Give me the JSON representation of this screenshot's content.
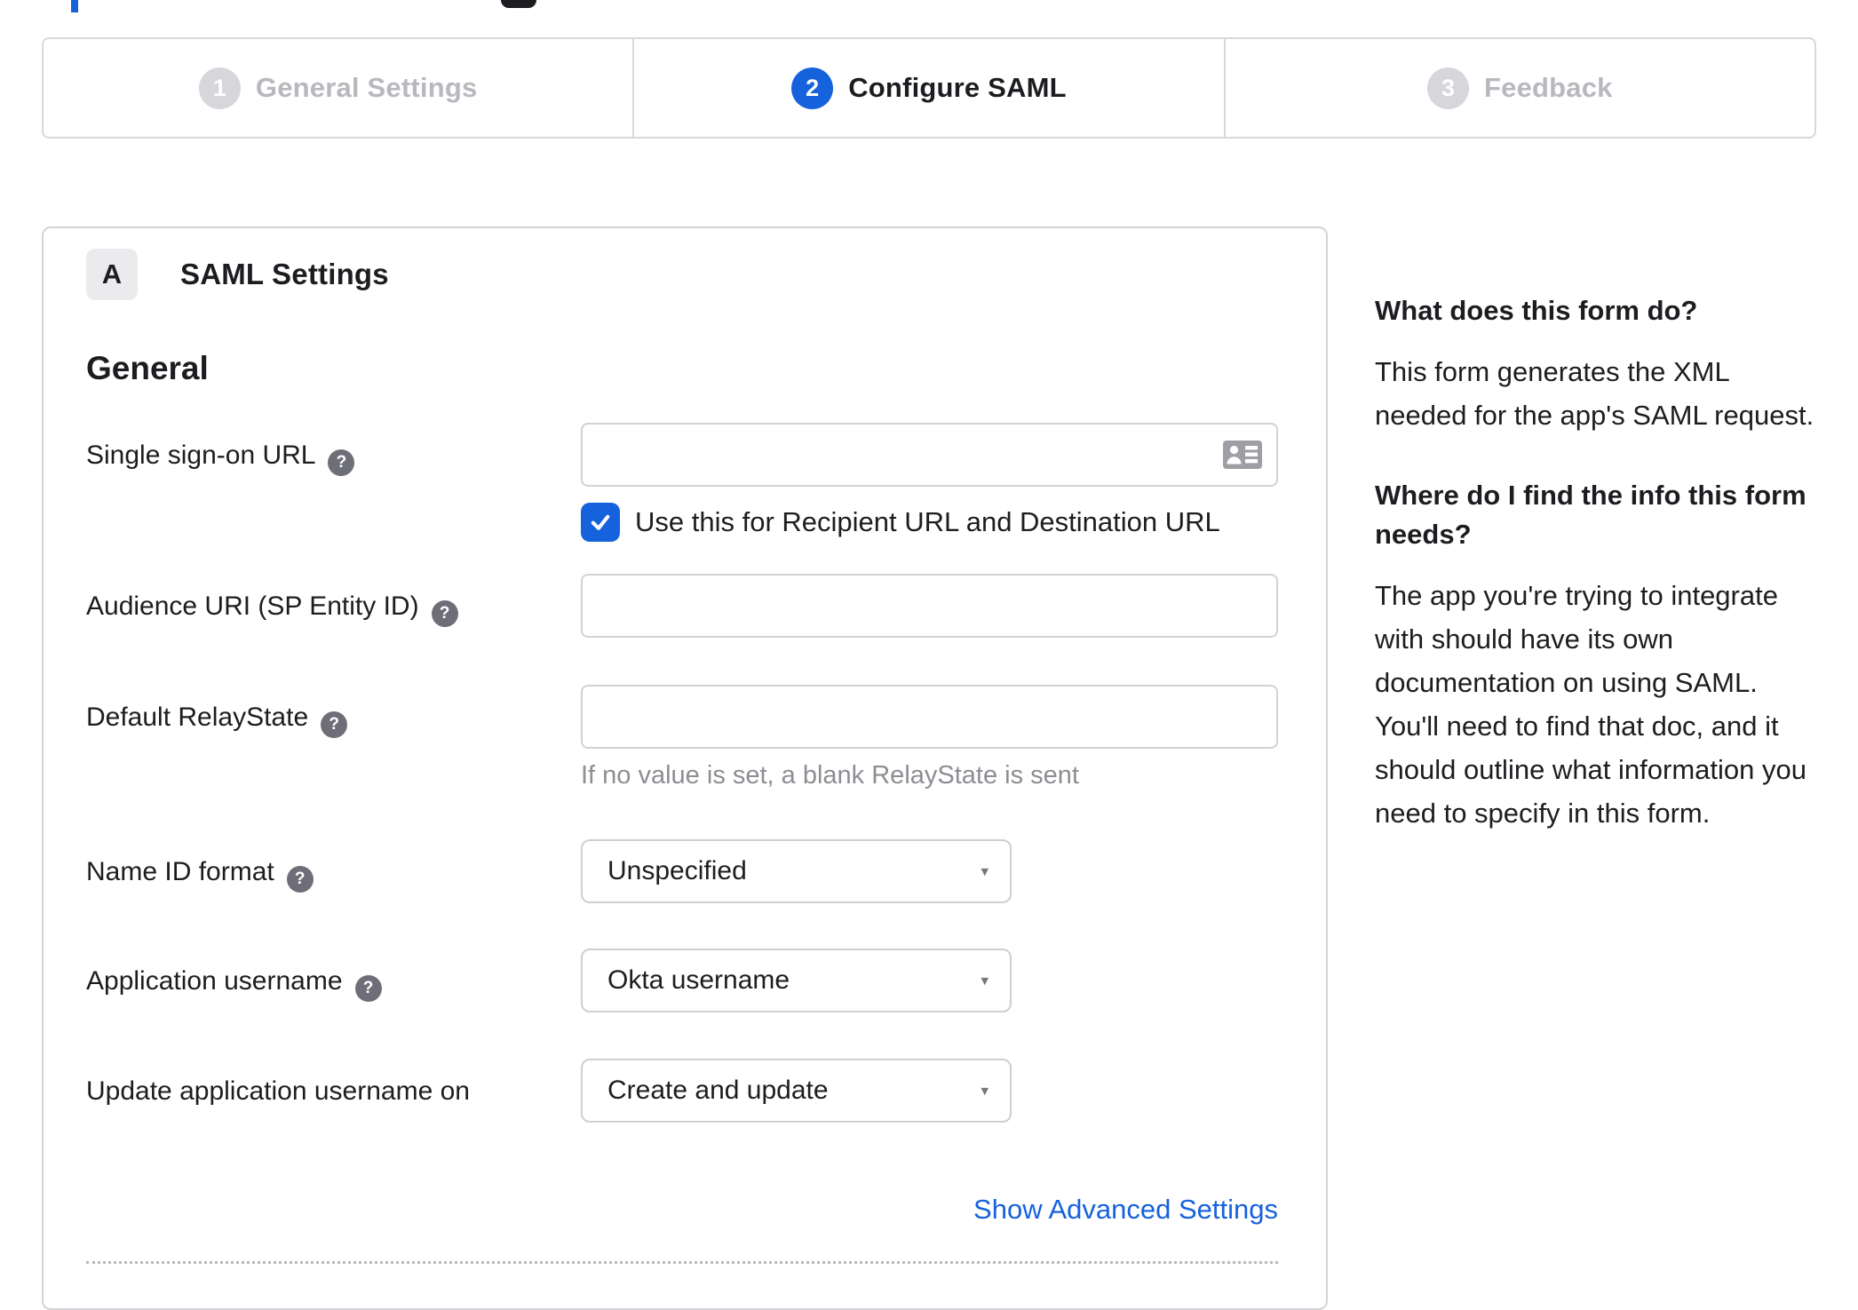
{
  "colors": {
    "accent_blue": "#1662dd",
    "inactive_gray": "#d6d6db",
    "text_dark": "#1d1d21"
  },
  "stepper": {
    "steps": [
      {
        "number": "1",
        "label": "General Settings",
        "state": "inactive"
      },
      {
        "number": "2",
        "label": "Configure SAML",
        "state": "active"
      },
      {
        "number": "3",
        "label": "Feedback",
        "state": "inactive"
      }
    ]
  },
  "panel": {
    "section_badge": "A",
    "section_title": "SAML Settings",
    "group_heading": "General",
    "fields": {
      "sso": {
        "label": "Single sign-on URL",
        "value": "",
        "checkbox_label": "Use this for Recipient URL and Destination URL",
        "checkbox_checked": true
      },
      "audience": {
        "label": "Audience URI (SP Entity ID)",
        "value": ""
      },
      "relay": {
        "label": "Default RelayState",
        "value": "",
        "hint": "If no value is set, a blank RelayState is sent"
      },
      "nameid": {
        "label": "Name ID format",
        "value": "Unspecified"
      },
      "appuser": {
        "label": "Application username",
        "value": "Okta username"
      },
      "updateuser": {
        "label": "Update application username on",
        "value": "Create and update"
      }
    },
    "advanced_link": "Show Advanced Settings"
  },
  "help": {
    "q1": "What does this form do?",
    "a1": "This form generates the XML needed for the app's SAML request.",
    "q2": "Where do I find the info this form needs?",
    "a2": "The app you're trying to integrate with should have its own documentation on using SAML. You'll need to find that doc, and it should outline what information you need to specify in this form."
  },
  "icons": {
    "help_glyph": "?",
    "caret_glyph": "▾"
  }
}
